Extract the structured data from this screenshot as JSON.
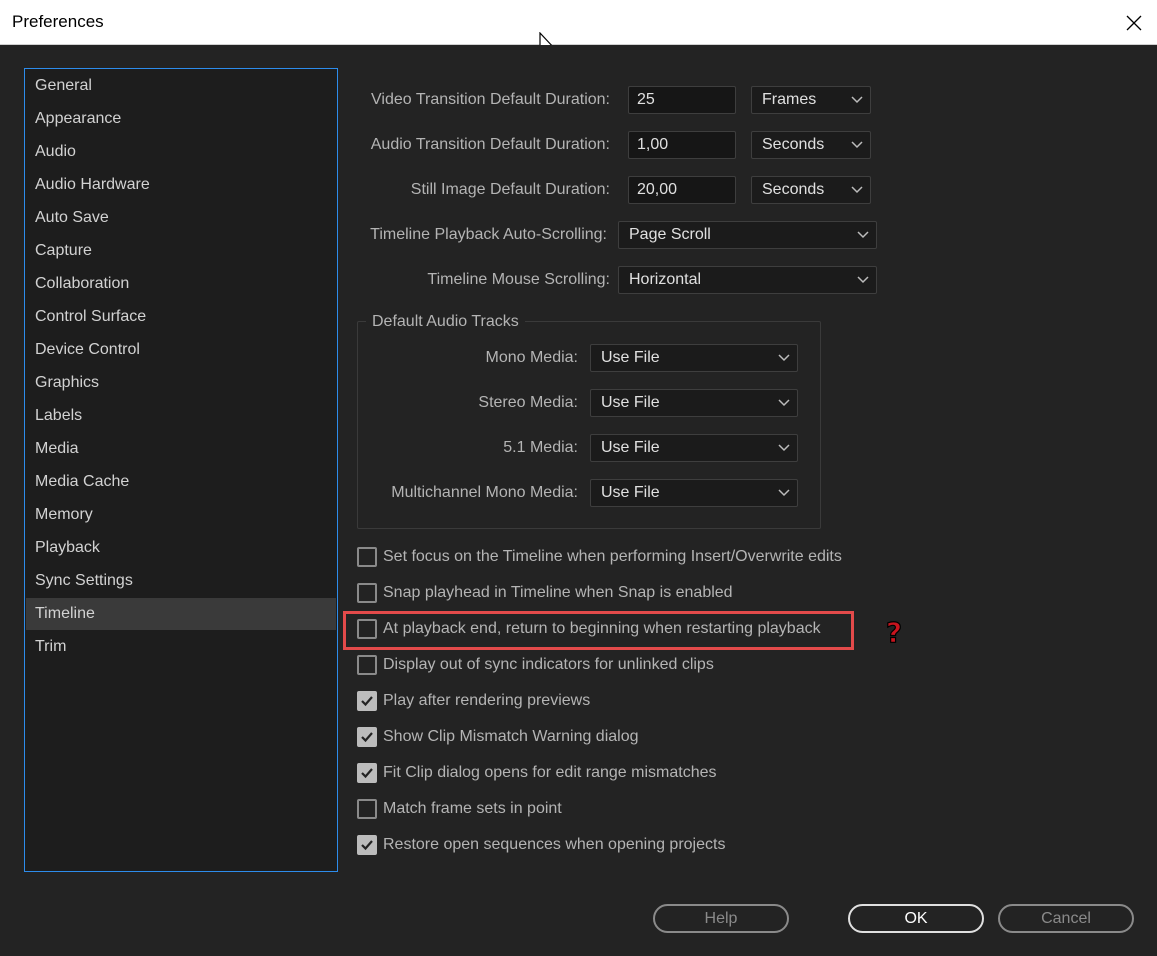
{
  "window": {
    "title": "Preferences"
  },
  "sidebar": {
    "items": [
      {
        "label": "General"
      },
      {
        "label": "Appearance"
      },
      {
        "label": "Audio"
      },
      {
        "label": "Audio Hardware"
      },
      {
        "label": "Auto Save"
      },
      {
        "label": "Capture"
      },
      {
        "label": "Collaboration"
      },
      {
        "label": "Control Surface"
      },
      {
        "label": "Device Control"
      },
      {
        "label": "Graphics"
      },
      {
        "label": "Labels"
      },
      {
        "label": "Media"
      },
      {
        "label": "Media Cache"
      },
      {
        "label": "Memory"
      },
      {
        "label": "Playback"
      },
      {
        "label": "Sync Settings"
      },
      {
        "label": "Timeline"
      },
      {
        "label": "Trim"
      }
    ],
    "selected": "Timeline"
  },
  "timeline": {
    "video_transition": {
      "label": "Video Transition Default Duration:",
      "value": "25",
      "unit": "Frames"
    },
    "audio_transition": {
      "label": "Audio Transition Default Duration:",
      "value": "1,00",
      "unit": "Seconds"
    },
    "still_image": {
      "label": "Still Image Default Duration:",
      "value": "20,00",
      "unit": "Seconds"
    },
    "auto_scrolling": {
      "label": "Timeline Playback Auto-Scrolling:",
      "value": "Page Scroll"
    },
    "mouse_scrolling": {
      "label": "Timeline Mouse Scrolling:",
      "value": "Horizontal"
    },
    "audio_tracks": {
      "title": "Default Audio Tracks",
      "mono": {
        "label": "Mono Media:",
        "value": "Use File"
      },
      "stereo": {
        "label": "Stereo Media:",
        "value": "Use File"
      },
      "surround": {
        "label": "5.1 Media:",
        "value": "Use File"
      },
      "multichannel": {
        "label": "Multichannel Mono Media:",
        "value": "Use File"
      }
    },
    "checkboxes": [
      {
        "label": "Set focus on the Timeline when performing Insert/Overwrite edits",
        "checked": false
      },
      {
        "label": "Snap playhead in Timeline when Snap is enabled",
        "checked": false
      },
      {
        "label": "At playback end, return to beginning when restarting playback",
        "checked": false
      },
      {
        "label": "Display out of sync indicators for unlinked clips",
        "checked": false
      },
      {
        "label": "Play after rendering previews",
        "checked": true
      },
      {
        "label": "Show Clip Mismatch Warning dialog",
        "checked": true
      },
      {
        "label": "Fit Clip dialog opens for edit range mismatches",
        "checked": true
      },
      {
        "label": "Match frame sets in point",
        "checked": false
      },
      {
        "label": "Restore open sequences when opening projects",
        "checked": true
      }
    ],
    "annotation_glyph": "?"
  },
  "buttons": {
    "help": "Help",
    "ok": "OK",
    "cancel": "Cancel"
  },
  "colors": {
    "accent": "#2d8ceb",
    "highlight": "#e34a4a",
    "question": "#c9141e"
  },
  "icons": {
    "close": "close-icon",
    "chevron": "chevron-down-icon",
    "check": "checkmark-icon",
    "question": "question-icon",
    "cursor": "mouse-cursor-icon"
  }
}
